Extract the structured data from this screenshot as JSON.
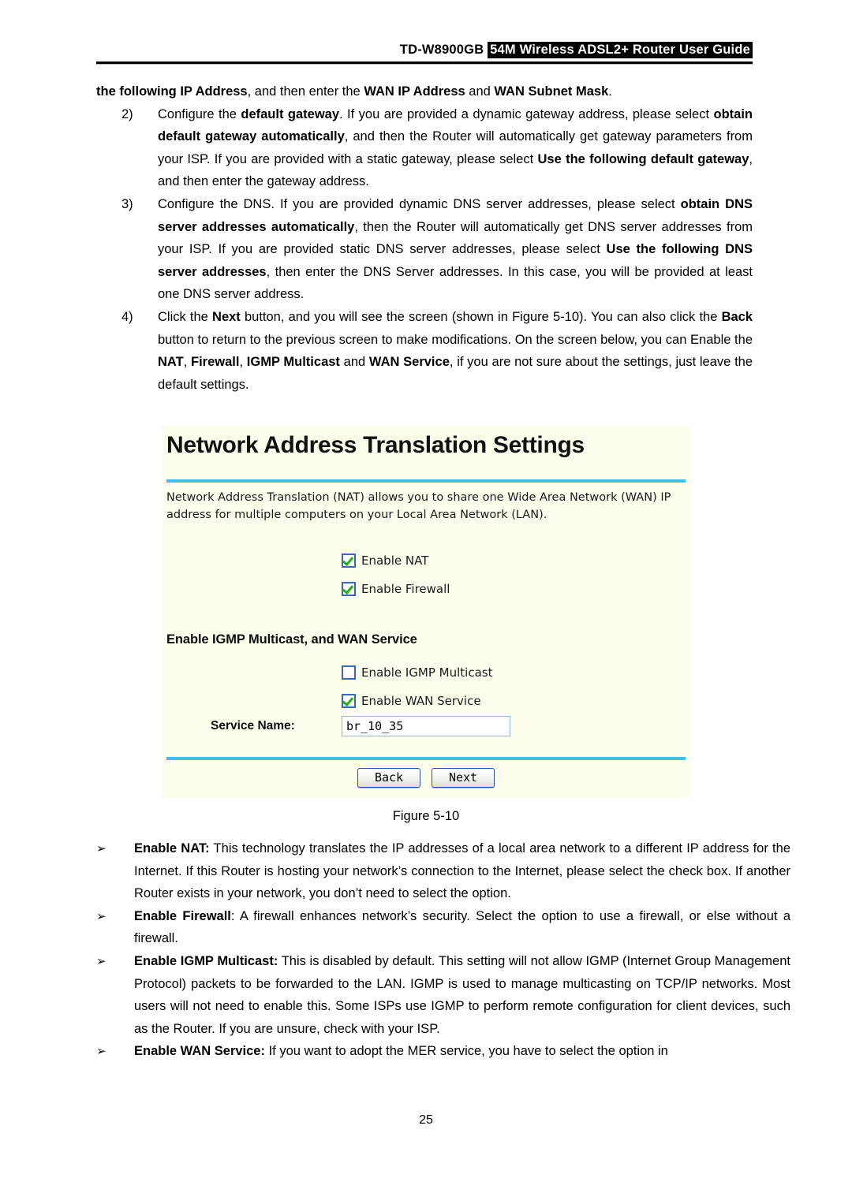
{
  "header": {
    "model": "TD-W8900GB",
    "title_inverted": "54M Wireless ADSL2+ Router User Guide"
  },
  "body": {
    "lead_html": "<b>the following IP Address</b>, and then enter the <b>WAN IP Address</b> and <b>WAN Subnet Mask</b>.",
    "numbered_items": [
      {
        "marker": "2)",
        "html": "Configure the <b>default gateway</b>. If you are provided a dynamic gateway address, please select <b>obtain default gateway automatically</b>, and then the Router will automatically get gateway parameters from your ISP. If you are provided with a static gateway, please select <b>Use the following default gateway</b>, and then enter the gateway address."
      },
      {
        "marker": "3)",
        "html": "Configure the DNS. If you are provided dynamic DNS server addresses, please select <b>obtain DNS server addresses automatically</b>, then the Router will automatically get DNS server addresses from your ISP. If you are provided static DNS server addresses, please select <b>Use the following DNS server addresses</b>, then enter the DNS Server addresses. In this case, you will be provided at least one DNS server address."
      },
      {
        "marker": "4)",
        "html": "Click the <b>Next</b> button, and you will see the screen (shown in Figure 5-10). You can also click the <b>Back</b> button to return to the previous screen to make modifications. On the screen below, you can Enable the <b>NAT</b>, <b>Firewall</b>, <b>IGMP Multicast</b> and <b>WAN Service</b>, if you are not sure about the settings, just leave the default settings."
      }
    ],
    "bullet_items": [
      {
        "marker": "➢",
        "html": "<b>Enable NAT:</b> This technology translates the IP addresses of a local area network to a different IP address for the Internet. If this Router is hosting your network’s connection to the Internet, please select the check box. If another Router exists in your network, you don’t need to select the option."
      },
      {
        "marker": "➢",
        "html": "<b>Enable Firewall</b>: A firewall enhances network’s security. Select the option to use a firewall, or else without a firewall."
      },
      {
        "marker": "➢",
        "html": "<b>Enable IGMP Multicast:</b> This is disabled by default. This setting will not allow IGMP (Internet Group Management Protocol) packets to be forwarded to the LAN. IGMP is used to manage multicasting on TCP/IP networks. Most users will not need to enable this. Some ISPs use IGMP to perform remote configuration for client devices, such as the Router. If you are unsure, check with your ISP."
      },
      {
        "marker": "➢",
        "html": "<b>Enable WAN Service:</b> If you want to adopt the MER service, you have to select the option in"
      }
    ],
    "figure_caption": "Figure 5-10",
    "page_number": "25"
  },
  "router_screen": {
    "title": "Network Address Translation Settings",
    "description": "Network Address Translation (NAT) allows you to share one Wide Area Network (WAN) IP address for multiple computers on your Local Area Network (LAN).",
    "checkboxes_primary": [
      {
        "label": "Enable NAT",
        "checked": true
      },
      {
        "label": "Enable Firewall",
        "checked": true
      }
    ],
    "section_heading": "Enable IGMP Multicast, and WAN Service",
    "checkboxes_secondary": [
      {
        "label": "Enable IGMP Multicast",
        "checked": false
      },
      {
        "label": "Enable WAN Service",
        "checked": true
      }
    ],
    "service_name_label": "Service Name:",
    "service_name_value": "br_10_35",
    "buttons": [
      {
        "label": "Back"
      },
      {
        "label": "Next"
      }
    ],
    "colors": {
      "panel_background": "#fdfdec",
      "divider": "#3cc0ea",
      "checkbox_border": "#3c66b8",
      "check_mark": "#22b014",
      "button_border": "#2a4fa0"
    }
  }
}
